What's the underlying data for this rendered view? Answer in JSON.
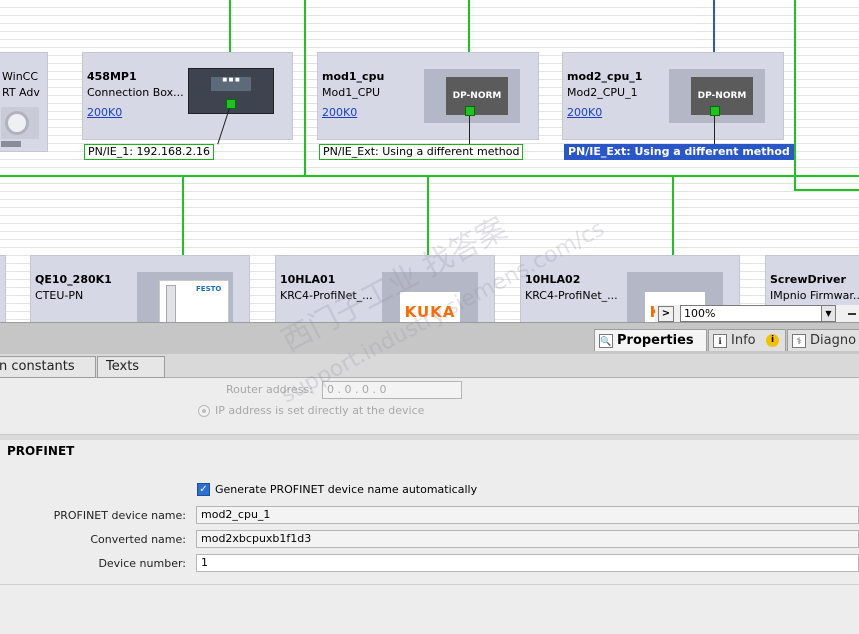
{
  "colors": {
    "subnet_line": "#1ec41e",
    "selected_line": "#2a57c8",
    "selected_label_bg": "#2a57c8",
    "device_bg": "#d6d8e6",
    "kuka_orange": "#ff6a00",
    "link_blue": "#1a3fc4"
  },
  "network": {
    "top_devices": [
      {
        "name": "WinCC",
        "type": "RT Adv",
        "icon": "hmi-panel-icon"
      },
      {
        "name": "458MP1",
        "type": "Connection Box...",
        "link": "200K0",
        "net_label": "PN/IE_1:  192.168.2.16",
        "icon": "siemens-connection-box-icon"
      },
      {
        "name": "mod1_cpu",
        "type": "Mod1_CPU",
        "link": "200K0",
        "box_text": "DP-NORM",
        "net_label": "PN/IE_Ext:  Using a different method"
      },
      {
        "name": "mod2_cpu_1",
        "type": "Mod2_CPU_1",
        "link": "200K0",
        "box_text": "DP-NORM",
        "net_label": "PN/IE_Ext:  Using a different method"
      }
    ],
    "bottom_devices": [
      {
        "name": "QE10_280K1",
        "type": "CTEU-PN",
        "brand": "FESTO"
      },
      {
        "name": "10HLA01",
        "type": "KRC4-ProfiNet_...",
        "brand": "KUKA"
      },
      {
        "name": "10HLA02",
        "type": "KRC4-ProfiNet_...",
        "brand": "KUKA"
      },
      {
        "name": "ScrewDriver",
        "type": "IMpnio  Firmwar..."
      }
    ],
    "zoom": "100%"
  },
  "inspector": {
    "tabs": [
      {
        "label": "Properties",
        "icon": "properties-icon"
      },
      {
        "label": "Info",
        "icon": "info-icon"
      },
      {
        "label": "Diagno",
        "icon": "diagnostics-icon"
      }
    ],
    "subtabs": [
      "n constants",
      "Texts"
    ],
    "router_address_label": "Router address:",
    "router_address_value": "0  .  0  .  0  .  0",
    "ip_radio_label": "IP address is set directly at the device",
    "section_title": "PROFINET",
    "generate_name_label": "Generate PROFINET device name automatically",
    "fields": {
      "device_name_label": "PROFINET device name:",
      "device_name_value": "mod2_cpu_1",
      "converted_name_label": "Converted name:",
      "converted_name_value": "mod2xbcpuxb1f1d3",
      "device_number_label": "Device number:",
      "device_number_value": "1"
    }
  },
  "watermark": {
    "text": "西门子工业 找答案",
    "url": "support.industry.siemens.com/cs"
  }
}
